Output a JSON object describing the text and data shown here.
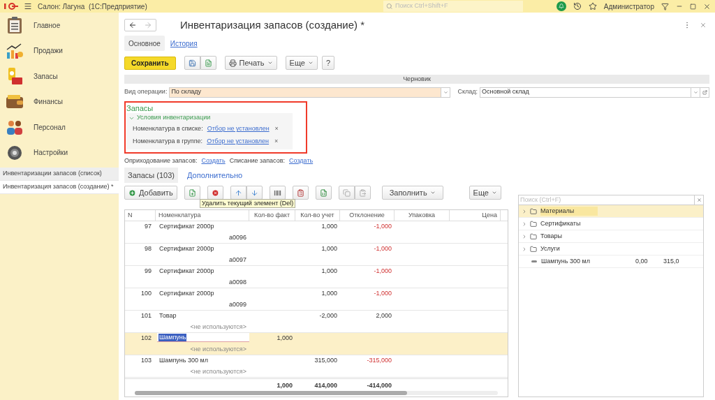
{
  "topbar": {
    "app_title": "Салон: Лагуна  (1С:Предприятие)",
    "search": {
      "placeholder": "Поиск Ctrl+Shift+F"
    },
    "user": "Администратор"
  },
  "sidebar": {
    "items": [
      {
        "label": "Главное",
        "kind": "main",
        "selected": false
      },
      {
        "label": "Продажи",
        "kind": "sales",
        "selected": false
      },
      {
        "label": "Запасы",
        "kind": "stock",
        "selected": false
      },
      {
        "label": "Финансы",
        "kind": "finance",
        "selected": false
      },
      {
        "label": "Персонал",
        "kind": "staff",
        "selected": false
      },
      {
        "label": "Настройки",
        "kind": "settings",
        "selected": false
      }
    ],
    "open_windows": [
      {
        "label": "Инвентаризации запасов (список)",
        "selected": false
      },
      {
        "label": "Инвентаризация запасов (создание) *",
        "selected": true
      }
    ]
  },
  "form": {
    "title": "Инвентаризация запасов (создание) *",
    "tabs": [
      {
        "label": "Основное",
        "selected": true
      },
      {
        "label": "История",
        "selected": false
      }
    ],
    "toolbar": {
      "save": "Сохранить",
      "print": "Печать",
      "more": "Еще",
      "help": "?"
    },
    "status": "Черновик",
    "operation": {
      "label": "Вид операции:",
      "value": "По складу"
    },
    "warehouse": {
      "label": "Склад:",
      "value": "Основной склад"
    },
    "stock_section": {
      "title": "Запасы",
      "conditions": {
        "title": "Условия инвентаризации",
        "expanded": true,
        "rows": [
          {
            "label": "Номенклатура в списке:",
            "link": "Отбор не установлен",
            "clear": "×"
          },
          {
            "label": "Номенклатура в группе:",
            "link": "Отбор не установлен",
            "clear": "×"
          }
        ]
      }
    },
    "documents": [
      {
        "label": "Оприходование запасов:",
        "link": "Создать"
      },
      {
        "label": "Списание запасов:",
        "link": "Создать"
      }
    ],
    "inner_tabs": [
      {
        "label": "Запасы (103)",
        "selected": true
      },
      {
        "label": "Дополнительно",
        "selected": false
      }
    ],
    "table_toolbar": {
      "add": "Добавить",
      "fill": "Заполнить",
      "more": "Еще",
      "tooltip": "Удалить текущий элемент (Del)"
    },
    "table": {
      "columns": [
        "N",
        "Номенклатура",
        "Кол-во факт",
        "Кол-во учет",
        "Отклонение",
        "Упаковка",
        "Цена"
      ],
      "rows": [
        {
          "n": "97",
          "name": "Сертификат 2000р",
          "sub": "a0096",
          "fact": "",
          "account": "1,000",
          "deviation": "-1,000",
          "negative": true,
          "selected": false,
          "editing": false
        },
        {
          "n": "98",
          "name": "Сертификат 2000р",
          "sub": "a0097",
          "fact": "",
          "account": "1,000",
          "deviation": "-1,000",
          "negative": true,
          "selected": false,
          "editing": false
        },
        {
          "n": "99",
          "name": "Сертификат 2000р",
          "sub": "a0098",
          "fact": "",
          "account": "1,000",
          "deviation": "-1,000",
          "negative": true,
          "selected": false,
          "editing": false
        },
        {
          "n": "100",
          "name": "Сертификат 2000р",
          "sub": "a0099",
          "fact": "",
          "account": "1,000",
          "deviation": "-1,000",
          "negative": true,
          "selected": false,
          "editing": false
        },
        {
          "n": "101",
          "name": "Товар",
          "sub": "<не используются>",
          "fact": "",
          "account": "-2,000",
          "deviation": "2,000",
          "negative": false,
          "selected": false,
          "editing": false
        },
        {
          "n": "102",
          "name": "Шампунь",
          "sub": "<не используются>",
          "fact": "1,000",
          "account": "",
          "deviation": "",
          "negative": false,
          "selected": true,
          "editing": true
        },
        {
          "n": "103",
          "name": "Шампунь 300 мл",
          "sub": "<не используются>",
          "fact": "",
          "account": "315,000",
          "deviation": "-315,000",
          "negative": true,
          "selected": false,
          "editing": false
        }
      ],
      "totals": {
        "fact": "1,000",
        "account": "414,000",
        "deviation": "-414,000"
      }
    }
  },
  "picker": {
    "search": {
      "placeholder": "Поиск (Ctrl+F)"
    },
    "items": [
      {
        "kind": "folder",
        "label": "Материалы",
        "selected": true
      },
      {
        "kind": "folder",
        "label": "Сертификаты",
        "selected": false
      },
      {
        "kind": "folder",
        "label": "Товары",
        "selected": false
      },
      {
        "kind": "folder",
        "label": "Услуги",
        "selected": false
      },
      {
        "kind": "item",
        "label": "Шампунь 300 мл",
        "column_2": "0,00",
        "column_3": "315,0",
        "selected": false
      }
    ]
  }
}
